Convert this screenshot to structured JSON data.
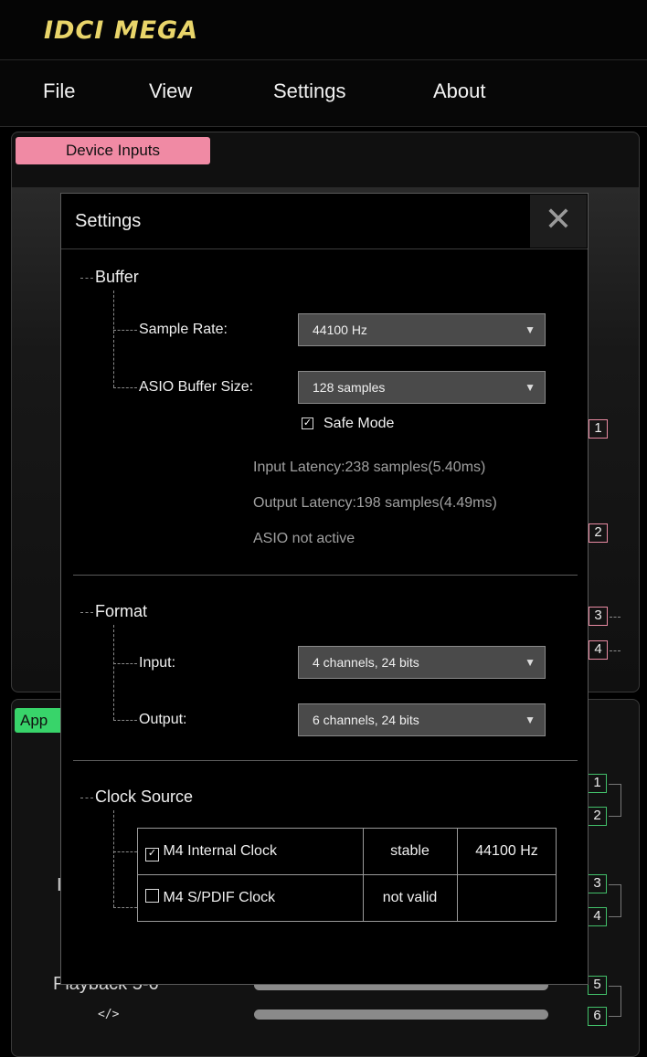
{
  "app": {
    "logo_text": "IDCI MEGA",
    "menu": [
      "File",
      "View",
      "Settings",
      "About"
    ]
  },
  "background": {
    "inputs_badge": "Device Inputs",
    "apps_badge_partial": "App",
    "phone_fragment": "I",
    "playback_label": "Playback 5-6",
    "code_icon": "</>",
    "channels_top": [
      "1",
      "2",
      "3",
      "4"
    ],
    "channels_bottom": [
      "1",
      "2",
      "3",
      "4",
      "5",
      "6"
    ]
  },
  "dialog": {
    "title": "Settings",
    "close_glyph": "✕",
    "buffer": {
      "title": "Buffer",
      "sample_rate_label": "Sample Rate:",
      "sample_rate_value": "44100 Hz",
      "asio_buffer_label": "ASIO Buffer Size:",
      "asio_buffer_value": "128  samples",
      "safe_mode_label": "Safe Mode",
      "safe_mode_checked": true,
      "input_latency": "Input Latency:238 samples(5.40ms)",
      "output_latency": "Output Latency:198 samples(4.49ms)",
      "asio_status": "ASIO not active"
    },
    "format": {
      "title": "Format",
      "input_label": "Input:",
      "input_value": "4  channels, 24 bits",
      "output_label": "Output:",
      "output_value": "6  channels, 24 bits"
    },
    "clock": {
      "title": "Clock Source",
      "rows": [
        {
          "name": "M4  Internal Clock",
          "checked": true,
          "status": "stable",
          "rate": "44100 Hz"
        },
        {
          "name": "M4  S/PDIF Clock",
          "checked": false,
          "status": "not valid",
          "rate": ""
        }
      ]
    }
  },
  "colors": {
    "logo": "#e9d56a",
    "inputs_badge": "#f08aa4",
    "apps_badge": "#38d46a",
    "dropdown_bg": "#4a4a4a"
  }
}
